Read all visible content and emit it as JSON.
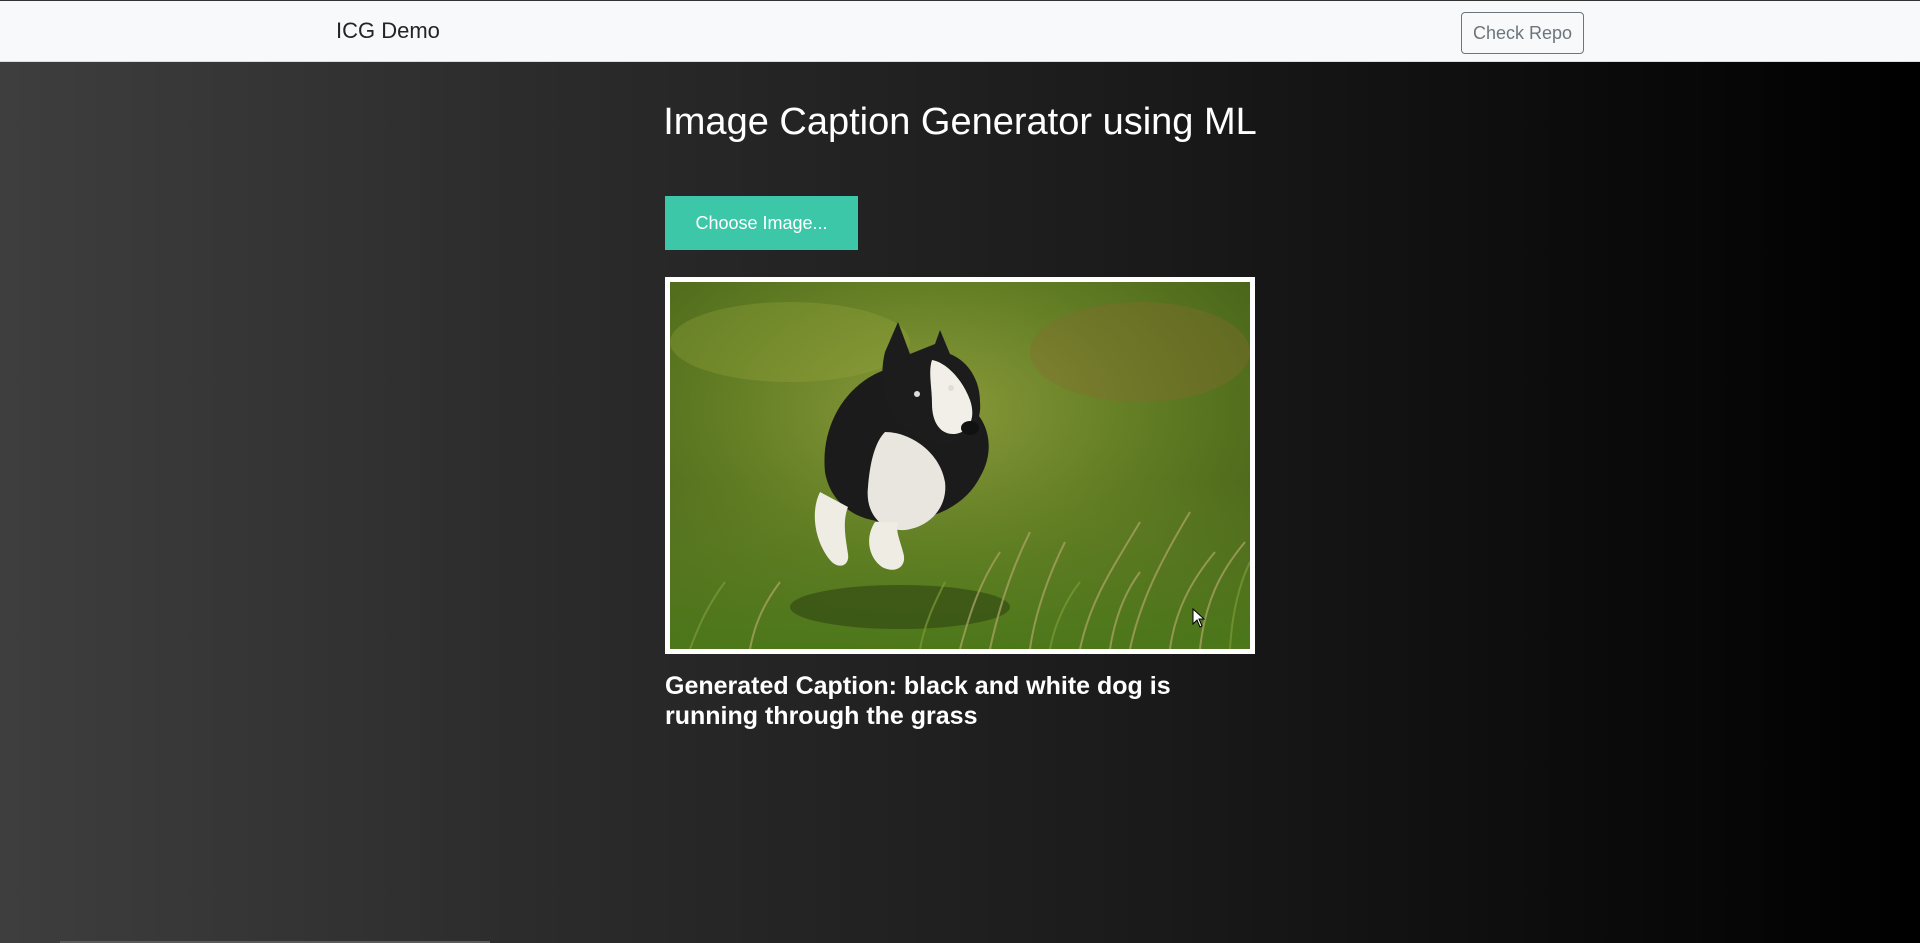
{
  "navbar": {
    "brand": "ICG Demo",
    "repo_button": "Check Repo"
  },
  "main": {
    "title": "Image Caption Generator using ML",
    "choose_button": "Choose Image...",
    "preview": {
      "subject": "black and white dog running through grass"
    },
    "caption": "Generated Caption: black and white dog is running through the grass"
  },
  "colors": {
    "accent": "#3cc8a8",
    "navbar_bg": "#f8f9fa",
    "repo_button_border": "#6c757d"
  }
}
